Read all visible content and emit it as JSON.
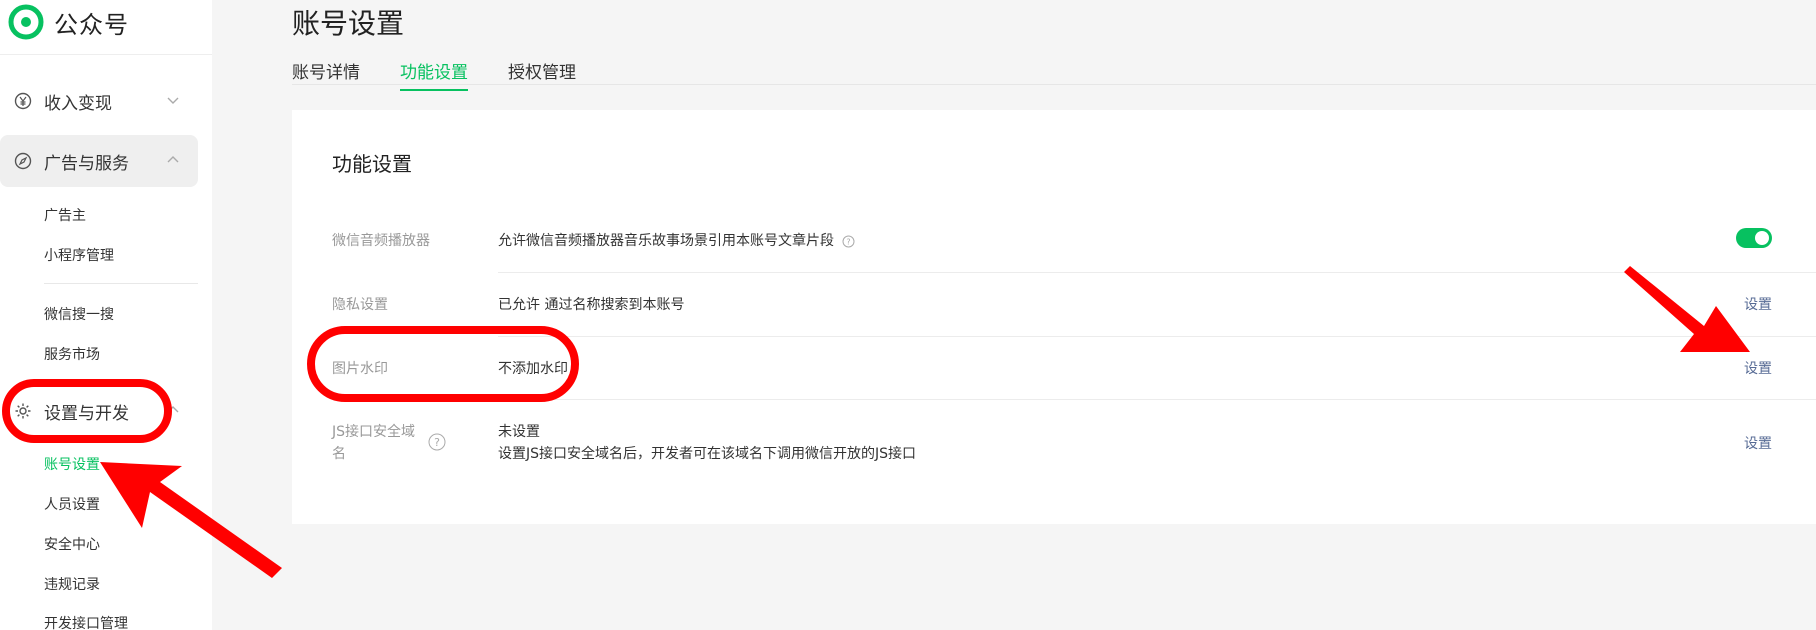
{
  "brand": {
    "name": "公众号",
    "color": "#07c160"
  },
  "sidebar": {
    "groups": [
      {
        "label": "收入变现",
        "icon": "yuan-icon",
        "expanded": false
      },
      {
        "label": "广告与服务",
        "icon": "compass-icon",
        "expanded": true
      },
      {
        "label": "设置与开发",
        "icon": "gear-icon",
        "expanded": true
      }
    ],
    "ads_items": [
      "广告主",
      "小程序管理",
      "微信搜一搜",
      "服务市场"
    ],
    "settings_items": [
      "账号设置",
      "人员设置",
      "安全中心",
      "违规记录",
      "开发接口管理"
    ]
  },
  "page": {
    "title": "账号设置",
    "tabs": [
      {
        "label": "账号详情",
        "active": false
      },
      {
        "label": "功能设置",
        "active": true
      },
      {
        "label": "授权管理",
        "active": false
      }
    ]
  },
  "card": {
    "title": "功能设置",
    "rows": [
      {
        "label": "微信音频播放器",
        "value": "允许微信音频播放器音乐故事场景引用本账号文章片段",
        "control": "toggle",
        "toggle_on": true
      },
      {
        "label": "隐私设置",
        "value": "已允许 通过名称搜索到本账号",
        "action": "设置"
      },
      {
        "label": "图片水印",
        "value": "不添加水印",
        "action": "设置"
      },
      {
        "label_line1": "JS接口安全域",
        "label_line2": "名",
        "value": "未设置",
        "value_sub": "设置JS接口安全域名后，开发者可在该域名下调用微信开放的JS接口",
        "action": "设置"
      }
    ]
  },
  "colors": {
    "accent": "#07c160",
    "link": "#576b95",
    "annotation": "#ff0000"
  }
}
